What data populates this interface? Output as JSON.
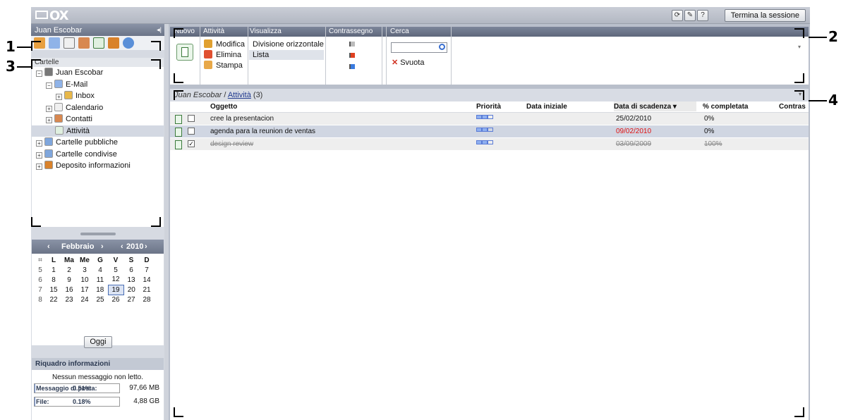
{
  "topbar": {
    "logo": "OX",
    "icons": [
      "refresh-icon",
      "settings-icon",
      "help-icon"
    ],
    "icon_glyphs": [
      "⟳",
      "✎",
      "?"
    ],
    "logout_label": "Termina la sessione"
  },
  "left": {
    "user": "Juan Escobar",
    "collapse_glyph": "◂|",
    "app_icons": [
      "home-icon",
      "email-icon",
      "calendar-icon",
      "contacts-icon",
      "tasks-icon",
      "infostore-icon",
      "settings-icon"
    ],
    "folders_header": "Cartelle",
    "tree": [
      {
        "label": "Juan Escobar",
        "exp": "−",
        "indent": 0,
        "icon": "user-icon"
      },
      {
        "label": "E-Mail",
        "exp": "−",
        "indent": 1,
        "icon": "email-icon"
      },
      {
        "label": "Inbox",
        "exp": "+",
        "indent": 2,
        "icon": "inbox-icon"
      },
      {
        "label": "Calendario",
        "exp": "+",
        "indent": 1,
        "icon": "calendar-icon"
      },
      {
        "label": "Contatti",
        "exp": "+",
        "indent": 1,
        "icon": "contacts-icon"
      },
      {
        "label": "Attività",
        "exp": "",
        "indent": 1,
        "icon": "tasks-icon",
        "selected": true
      },
      {
        "label": "Cartelle pubbliche",
        "exp": "+",
        "indent": 0,
        "icon": "folder-icon"
      },
      {
        "label": "Cartelle condivise",
        "exp": "+",
        "indent": 0,
        "icon": "folder-icon"
      },
      {
        "label": "Deposito informazioni",
        "exp": "+",
        "indent": 0,
        "icon": "infostore-icon"
      }
    ]
  },
  "calendar": {
    "month": "Febbraio",
    "year": "2010",
    "prev": "‹",
    "next": "›",
    "days": [
      "L",
      "Ma",
      "Me",
      "G",
      "V",
      "S",
      "D"
    ],
    "weeks": [
      {
        "wk": "5",
        "d": [
          "1",
          "2",
          "3",
          "4",
          "5",
          "6",
          "7"
        ]
      },
      {
        "wk": "6",
        "d": [
          "8",
          "9",
          "10",
          "11",
          "12",
          "13",
          "14"
        ]
      },
      {
        "wk": "7",
        "d": [
          "15",
          "16",
          "17",
          "18",
          "19",
          "20",
          "21"
        ]
      },
      {
        "wk": "8",
        "d": [
          "22",
          "23",
          "24",
          "25",
          "26",
          "27",
          "28"
        ]
      }
    ],
    "today": "19",
    "today_label": "Oggi"
  },
  "info_panel": {
    "title": "Riquadro informazioni",
    "message": "Nessun messaggio non letto.",
    "quota_rows": [
      {
        "label": "Messaggio di posta:",
        "pct": "0.51%",
        "value": "97,66 MB",
        "fill": 0.0051
      },
      {
        "label": "File:",
        "pct": "0.18%",
        "value": "4,88 GB",
        "fill": 0.0018
      }
    ]
  },
  "ribbon": {
    "headers": [
      "Nuovo",
      "Attività",
      "Visualizza",
      "Contrassegno",
      "Cerca"
    ],
    "actions": [
      {
        "label": "Modifica",
        "icon": "edit-icon",
        "color": "#e0a030"
      },
      {
        "label": "Elimina",
        "icon": "delete-icon",
        "color": "#e05030"
      },
      {
        "label": "Stampa",
        "icon": "print-icon",
        "color": "#e8a848"
      }
    ],
    "view_options": [
      "Divisione orizzontale",
      "Lista"
    ],
    "flags": [
      "flag-clear-icon",
      "flag-red-icon",
      "flag-blue-icon"
    ],
    "clear_label": "Svuota",
    "search_value": ""
  },
  "list": {
    "owner": "Juan Escobar",
    "folder": "Attività",
    "count": "(3)",
    "columns": [
      "Oggetto",
      "Priorità",
      "Data iniziale",
      "Data di scadenza ▾",
      "% completata",
      "Contras"
    ],
    "rows": [
      {
        "subject": "cree la presentacion",
        "start": "",
        "due": "25/02/2010",
        "pct": "0%",
        "done": false,
        "overdue": false
      },
      {
        "subject": "agenda para la reunion de ventas",
        "start": "",
        "due": "09/02/2010",
        "pct": "0%",
        "done": false,
        "overdue": true
      },
      {
        "subject": "design review",
        "start": "",
        "due": "03/09/2009",
        "pct": "100%",
        "done": true,
        "overdue": false
      }
    ]
  },
  "callouts": [
    "1",
    "2",
    "3",
    "4"
  ]
}
